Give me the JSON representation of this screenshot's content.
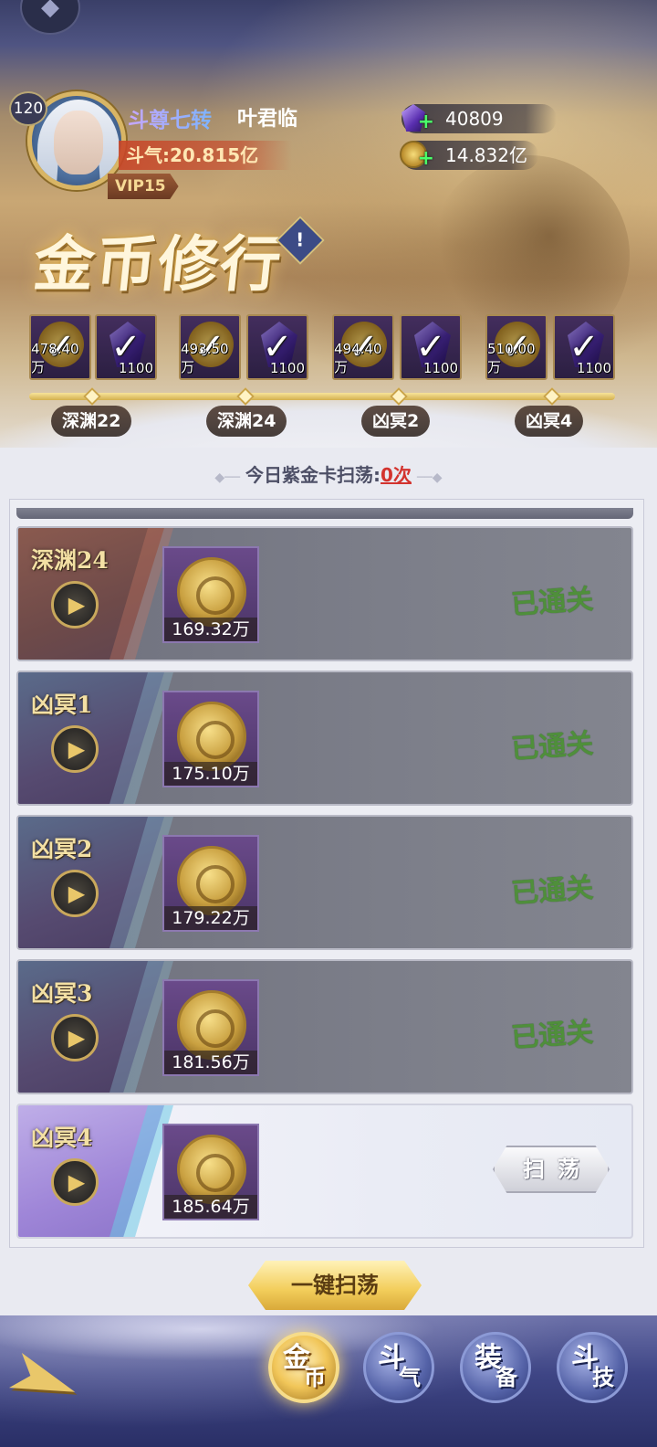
{
  "player": {
    "level": "120",
    "rank_title": "斗尊七转",
    "name": "叶君临",
    "power_label": "斗气:20.815亿",
    "vip": "VIP15"
  },
  "currency": {
    "gem": {
      "icon": "purple-crystal-icon",
      "value": "40809"
    },
    "gold": {
      "icon": "gold-coin-icon",
      "value": "14.832亿"
    }
  },
  "event": {
    "title": "金币修行",
    "info_icon": "!"
  },
  "milestones": [
    {
      "coin_amount": "478.40万",
      "gem_amount": "1100",
      "stage": "深渊22",
      "claimed": true
    },
    {
      "coin_amount": "493.50万",
      "gem_amount": "1100",
      "stage": "深渊24",
      "claimed": true
    },
    {
      "coin_amount": "494.40万",
      "gem_amount": "1100",
      "stage": "凶冥2",
      "claimed": true
    },
    {
      "coin_amount": "510.00万",
      "gem_amount": "1100",
      "stage": "凶冥4",
      "claimed": true
    }
  ],
  "sweep_counter": {
    "label": "今日紫金卡扫荡:",
    "count": "0次"
  },
  "stages": [
    {
      "name": "深渊24",
      "reward": "169.32万",
      "status": "已通关",
      "kind": "abyss"
    },
    {
      "name": "凶冥1",
      "reward": "175.10万",
      "status": "已通关",
      "kind": "nether"
    },
    {
      "name": "凶冥2",
      "reward": "179.22万",
      "status": "已通关",
      "kind": "nether"
    },
    {
      "name": "凶冥3",
      "reward": "181.56万",
      "status": "已通关",
      "kind": "nether"
    },
    {
      "name": "凶冥4",
      "reward": "185.64万",
      "button": "扫荡",
      "kind": "active"
    }
  ],
  "one_click_sweep": "一键扫荡",
  "nav": {
    "tabs": [
      {
        "ch1": "金",
        "ch2": "币",
        "selected": true
      },
      {
        "ch1": "斗",
        "ch2": "气",
        "selected": false
      },
      {
        "ch1": "装",
        "ch2": "备",
        "selected": false
      },
      {
        "ch1": "斗",
        "ch2": "技",
        "selected": false
      }
    ]
  }
}
